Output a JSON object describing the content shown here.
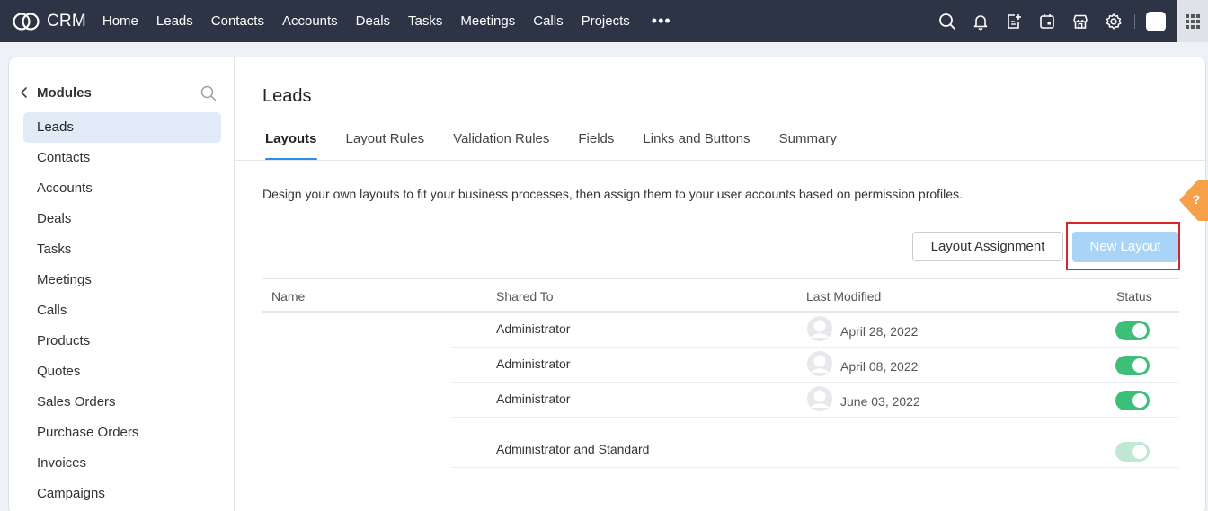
{
  "app": {
    "name": "CRM"
  },
  "nav": {
    "items": [
      "Home",
      "Leads",
      "Contacts",
      "Accounts",
      "Deals",
      "Tasks",
      "Meetings",
      "Calls",
      "Projects"
    ],
    "more": "•••"
  },
  "top_icons": [
    "search-icon",
    "bell-icon",
    "add-note-icon",
    "calendar-icon",
    "store-icon",
    "gear-icon"
  ],
  "sidebar": {
    "title": "Modules",
    "items": [
      "Leads",
      "Contacts",
      "Accounts",
      "Deals",
      "Tasks",
      "Meetings",
      "Calls",
      "Products",
      "Quotes",
      "Sales Orders",
      "Purchase Orders",
      "Invoices",
      "Campaigns"
    ],
    "active": "Leads"
  },
  "page": {
    "title": "Leads",
    "tabs": [
      "Layouts",
      "Layout Rules",
      "Validation Rules",
      "Fields",
      "Links and Buttons",
      "Summary"
    ],
    "active_tab": "Layouts",
    "description": "Design your own layouts to fit your business processes, then assign them to your user accounts based on permission profiles.",
    "layout_assignment_label": "Layout Assignment",
    "new_layout_label": "New Layout"
  },
  "table": {
    "headers": {
      "name": "Name",
      "shared_to": "Shared To",
      "last_modified": "Last Modified",
      "status": "Status"
    },
    "rows": [
      {
        "shared_to": "Administrator",
        "last_modified": "April 28, 2022",
        "status": "on"
      },
      {
        "shared_to": "Administrator",
        "last_modified": "April 08, 2022",
        "status": "on"
      },
      {
        "shared_to": "Administrator",
        "last_modified": "June 03, 2022",
        "status": "on"
      },
      {
        "shared_to": "Administrator and Standard",
        "last_modified": "",
        "status": "disabled-on"
      }
    ]
  },
  "help": {
    "label": "?"
  },
  "colors": {
    "topbar": "#2d3446",
    "accent": "#2d8ce6",
    "toggle_on": "#3ebf78",
    "highlight": "#d7262b",
    "help_tab": "#f6a14a"
  }
}
